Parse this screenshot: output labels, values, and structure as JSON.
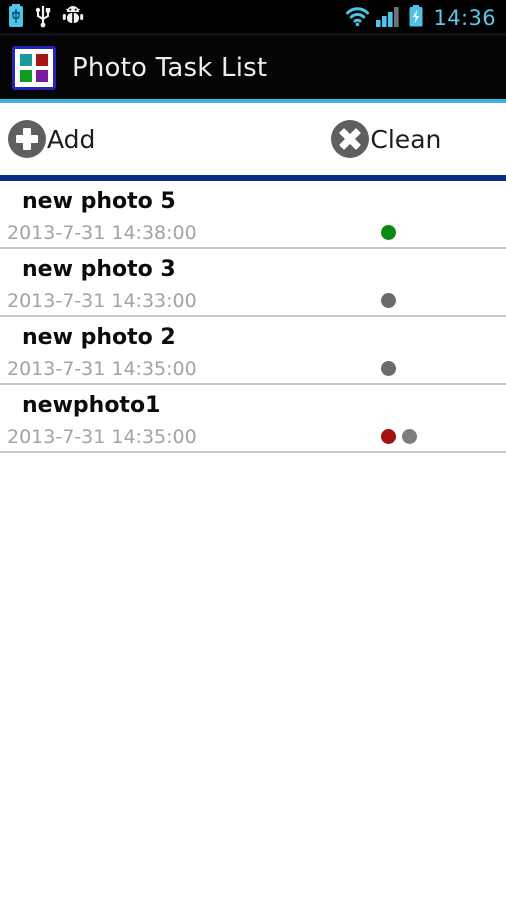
{
  "status_bar": {
    "time": "14:36",
    "left_icons": [
      "battery-status-icon",
      "usb-icon",
      "android-debug-icon"
    ],
    "right_icons": [
      "wifi-icon",
      "signal-bars-icon",
      "battery-charging-icon"
    ],
    "accent_color": "#5ec8e8",
    "background": "#000000"
  },
  "title_bar": {
    "title": "Photo Task List",
    "icon_name": "app-grid-icon",
    "icon_colors": [
      "#1a9b9b",
      "#a81414",
      "#0f9c22",
      "#7a1a9c"
    ],
    "icon_border": "#2424b8",
    "accent_line": "#3ab5e0",
    "background": "#050505",
    "text_color": "#eeeeee"
  },
  "action_bar": {
    "add_label": "Add",
    "add_icon": "plus-circle-icon",
    "clean_label": "Clean",
    "clean_icon": "close-circle-icon",
    "icon_color": "#5f5f5f",
    "divider_color": "#0d2d8c"
  },
  "list": {
    "separator_color": "#c9c9c9",
    "items": [
      {
        "title": "new photo 5",
        "date": "2013-7-31 14:38:00",
        "dots": [
          "#0a8a14"
        ]
      },
      {
        "title": "new photo 3",
        "date": "2013-7-31 14:33:00",
        "dots": [
          "#6b6b6b"
        ]
      },
      {
        "title": "new photo 2",
        "date": "2013-7-31 14:35:00",
        "dots": [
          "#6b6b6b"
        ]
      },
      {
        "title": "newphoto1",
        "date": "2013-7-31 14:35:00",
        "dots": [
          "#a51014",
          "#7d7d7d"
        ]
      }
    ]
  }
}
